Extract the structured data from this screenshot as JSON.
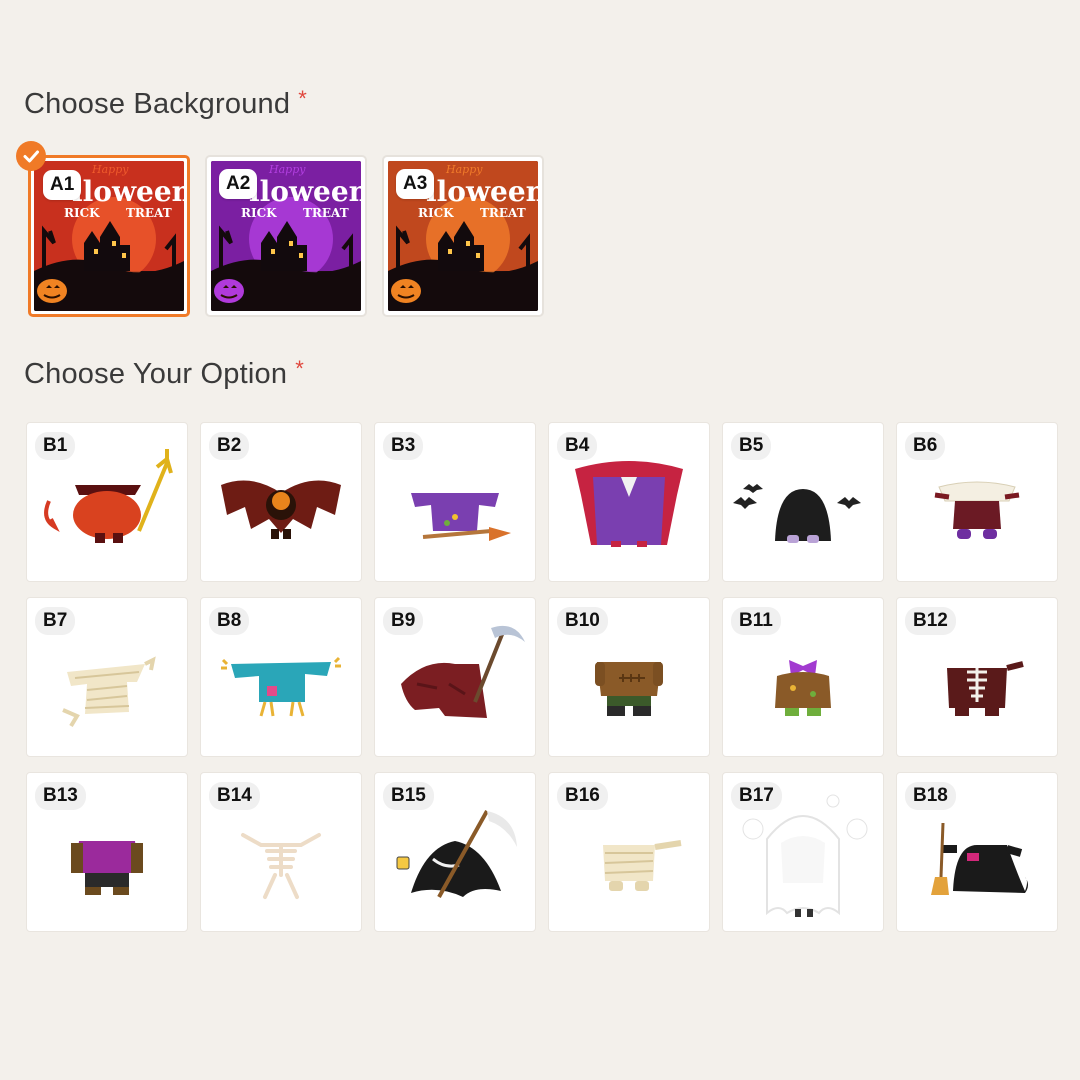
{
  "background_section": {
    "title": "Choose Background",
    "required_mark": "*",
    "options": [
      {
        "code": "A1",
        "theme_color": "#c8301e",
        "sky_color": "#ef5a2c",
        "selected": true
      },
      {
        "code": "A2",
        "theme_color": "#7b1fa2",
        "sky_color": "#b23fe0",
        "selected": false
      },
      {
        "code": "A3",
        "theme_color": "#c0481e",
        "sky_color": "#f07a2a",
        "selected": false
      }
    ],
    "thumbnail_text": {
      "top": "Happy",
      "main": "lloween",
      "sub_left": "RICK",
      "sub_right": "TREAT"
    },
    "selected_icon": "check-icon"
  },
  "option_section": {
    "title": "Choose Your Option",
    "required_mark": "*",
    "options": [
      {
        "code": "B1",
        "costume": "devil-costume-icon"
      },
      {
        "code": "B2",
        "costume": "bat-costume-icon"
      },
      {
        "code": "B3",
        "costume": "witch-broom-costume-icon"
      },
      {
        "code": "B4",
        "costume": "vampire-costume-icon"
      },
      {
        "code": "B5",
        "costume": "bat-cape-costume-icon"
      },
      {
        "code": "B6",
        "costume": "pirate-costume-icon"
      },
      {
        "code": "B7",
        "costume": "mummy-costume-icon"
      },
      {
        "code": "B8",
        "costume": "scarecrow-costume-icon"
      },
      {
        "code": "B9",
        "costume": "grim-reaper-costume-icon"
      },
      {
        "code": "B10",
        "costume": "frankenstein-costume-icon"
      },
      {
        "code": "B11",
        "costume": "bow-dress-costume-icon"
      },
      {
        "code": "B12",
        "costume": "skeleton-suit-costume-icon"
      },
      {
        "code": "B13",
        "costume": "dracula-costume-icon"
      },
      {
        "code": "B14",
        "costume": "skeleton-costume-icon"
      },
      {
        "code": "B15",
        "costume": "reaper-cloak-costume-icon"
      },
      {
        "code": "B16",
        "costume": "mummy-wrap-costume-icon"
      },
      {
        "code": "B17",
        "costume": "ghost-costume-icon"
      },
      {
        "code": "B18",
        "costume": "witch-costume-icon"
      }
    ]
  },
  "colors": {
    "accent": "#f07a27",
    "required": "#e0473d",
    "page_bg": "#f3f0eb"
  }
}
